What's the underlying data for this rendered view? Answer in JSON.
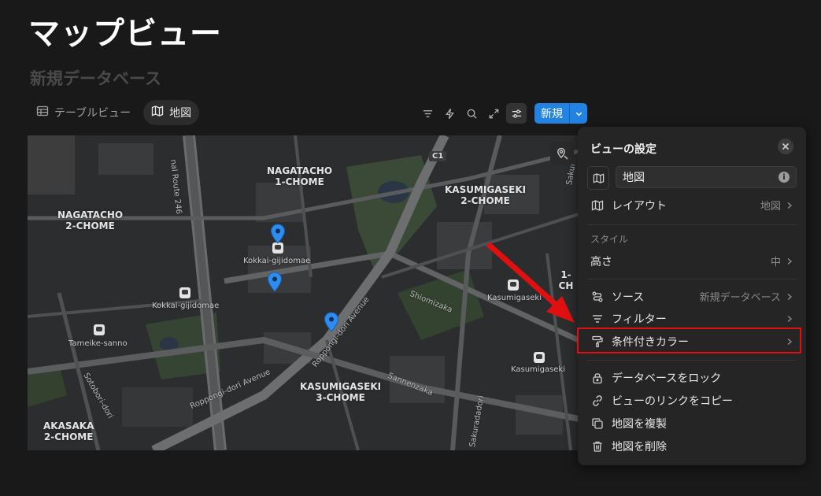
{
  "page": {
    "title": "マップビュー",
    "database_title": "新規データベース"
  },
  "tabs": [
    {
      "label": "テーブルビュー",
      "icon": "table-icon",
      "active": false
    },
    {
      "label": "地図",
      "icon": "map-icon",
      "active": true
    }
  ],
  "toolbar": {
    "icons": [
      "filter-icon",
      "lightning-icon",
      "search-icon",
      "expand-icon",
      "sliders-icon"
    ],
    "new_label": "新規",
    "accent": "#2383e2"
  },
  "map": {
    "areas": [
      {
        "name": "NAGATACHO\n1-CHOME"
      },
      {
        "name": "KASUMIGASEKI\n2-CHOME"
      },
      {
        "name": "NAGATACHO\n2-CHOME"
      },
      {
        "name": "KASUMIGASEKI\n3-CHOME"
      },
      {
        "name": "AKASAKA\n2-CHOME"
      },
      {
        "name": "1-CH"
      }
    ],
    "stations": [
      "Kokkai-gijidomae",
      "Kokkai-gijidomae",
      "Tameike-sanno",
      "Kasumigaseki",
      "Kasumigaseki"
    ],
    "streets": [
      "nal Route 246",
      "Roppongi-dori Avenue",
      "Roppongi-dori Avenue",
      "Shiomizaka",
      "Sannenzaka",
      "Sotobori-dori",
      "Sakuradadori",
      "Sakur"
    ],
    "expressway": "C1",
    "pin_color": "#2d8cf0"
  },
  "settings": {
    "header": "ビューの設定",
    "view_name": "地図",
    "layout": {
      "label": "レイアウト",
      "value": "地図"
    },
    "style_section": "スタイル",
    "height": {
      "label": "高さ",
      "value": "中"
    },
    "source": {
      "label": "ソース",
      "value": "新規データベース"
    },
    "filter": {
      "label": "フィルター"
    },
    "conditional_color": {
      "label": "条件付きカラー"
    },
    "lock": {
      "label": "データベースをロック"
    },
    "copy_link": {
      "label": "ビューのリンクをコピー"
    },
    "duplicate": {
      "label": "地図を複製"
    },
    "delete": {
      "label": "地図を削除"
    }
  },
  "annotation": {
    "highlight_color": "#e01010"
  }
}
